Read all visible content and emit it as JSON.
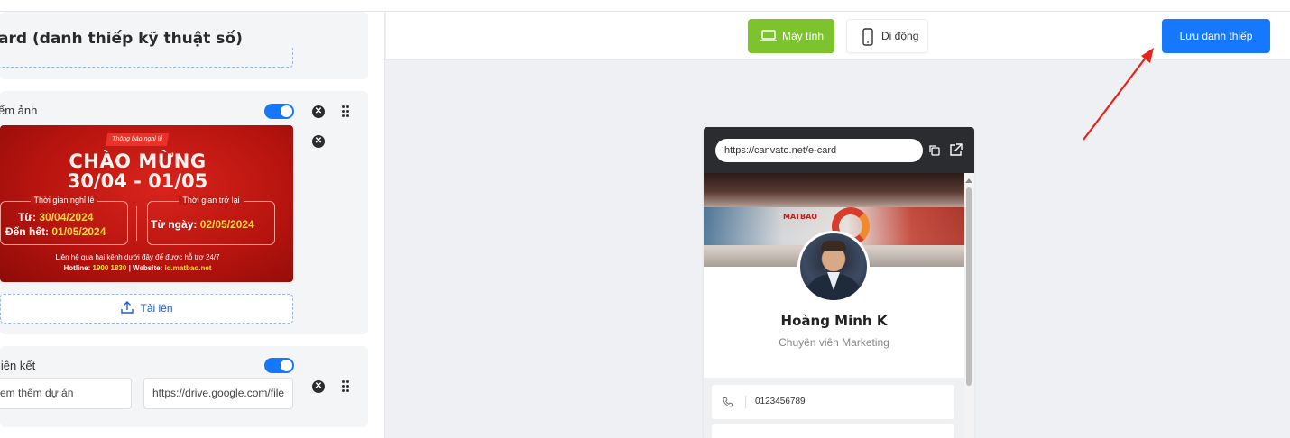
{
  "editor": {
    "title": "ard (danh thiếp kỹ thuật số)",
    "image_block": {
      "label": "ếm ảnh",
      "upload_label": "Tải lên"
    },
    "link_block": {
      "label": "liên kết",
      "name_value": "em thêm dự án",
      "url_value": "https://drive.google.com/file"
    }
  },
  "banner": {
    "tag": "Thông báo nghỉ lễ",
    "line1": "CHÀO MỪNG",
    "line2": "30/04 - 01/05",
    "box_left_caption": "Thời gian nghỉ lễ",
    "from_label": "Từ:",
    "from_date": "30/04/2024",
    "to_label": "Đến hết:",
    "to_date": "01/05/2024",
    "box_right_caption": "Thời gian trở lại",
    "return_label": "Từ ngày:",
    "return_date": "02/05/2024",
    "foot1": "Liên hệ qua hai kênh dưới đây để được hỗ trợ 24/7",
    "foot_hotline_label": "Hotline:",
    "foot_hotline": "1900 1830",
    "foot_web_label": "| Website:",
    "foot_web": "id.matbao.net"
  },
  "header": {
    "desktop_label": "Máy tính",
    "mobile_label": "Di động",
    "save_label": "Lưu danh thiếp"
  },
  "preview": {
    "url": "https://canvato.net/e-card",
    "cover_logo": "MATBAO",
    "name": "Hoàng Minh K",
    "role": "Chuyên viên Marketing",
    "phone": "0123456789"
  },
  "colors": {
    "primary": "#1677ff",
    "desktop_active": "#7cc32e",
    "banner_red": "#c21a13",
    "banner_yellow": "#ffd93b",
    "annotation_arrow": "#e8231a"
  }
}
